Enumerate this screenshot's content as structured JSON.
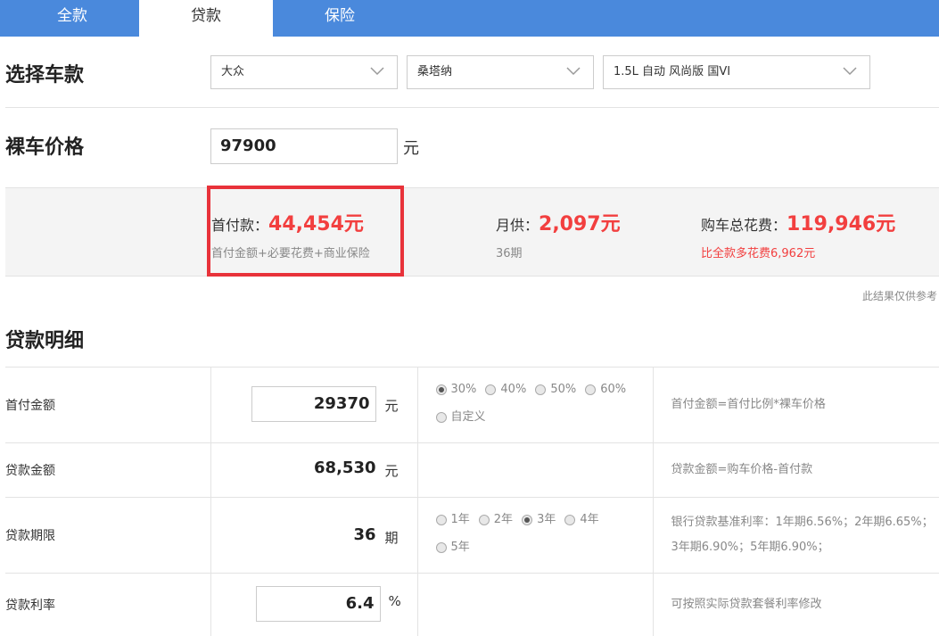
{
  "tabs": [
    {
      "label": "全款",
      "active": false
    },
    {
      "label": "贷款",
      "active": true
    },
    {
      "label": "保险",
      "active": false
    }
  ],
  "car_select": {
    "title": "选择车款",
    "brand": "大众",
    "model": "桑塔纳",
    "trim": "1.5L 自动 风尚版 国VI"
  },
  "price": {
    "title": "裸车价格",
    "value": "97900",
    "unit": "元"
  },
  "summary": {
    "down_label": "首付款：",
    "down_value": "44,454元",
    "down_sub": "首付金额+必要花费+商业保险",
    "monthly_label": "月供：",
    "monthly_value": "2,097元",
    "monthly_sub": "36期",
    "total_label": "购车总花费：",
    "total_value": "119,946元",
    "total_sub": "比全款多花费6,962元",
    "highlight_color": "#e8323a",
    "value_color": "#f23f3f"
  },
  "note": "此结果仅供参考",
  "detail": {
    "title": "贷款明细",
    "rows": [
      {
        "label": "首付金额",
        "value": "29370",
        "unit": "元",
        "options": [
          "30%",
          "40%",
          "50%",
          "60%",
          "自定义"
        ],
        "selected": 0,
        "desc": "首付金额=首付比例*裸车价格"
      },
      {
        "label": "贷款金额",
        "value": "68,530",
        "unit": "元",
        "desc": "贷款金额=购车价格-首付款"
      },
      {
        "label": "贷款期限",
        "value": "36",
        "unit": "期",
        "options": [
          "1年",
          "2年",
          "3年",
          "4年",
          "5年"
        ],
        "selected": 2,
        "desc": "银行贷款基准利率：1年期6.56%；2年期6.65%；3年期6.90%；5年期6.90%；"
      },
      {
        "label": "贷款利率",
        "value": "6.4",
        "unit": "%",
        "desc": "可按照实际贷款套餐利率修改"
      }
    ]
  },
  "accent_color": "#4a89dc"
}
